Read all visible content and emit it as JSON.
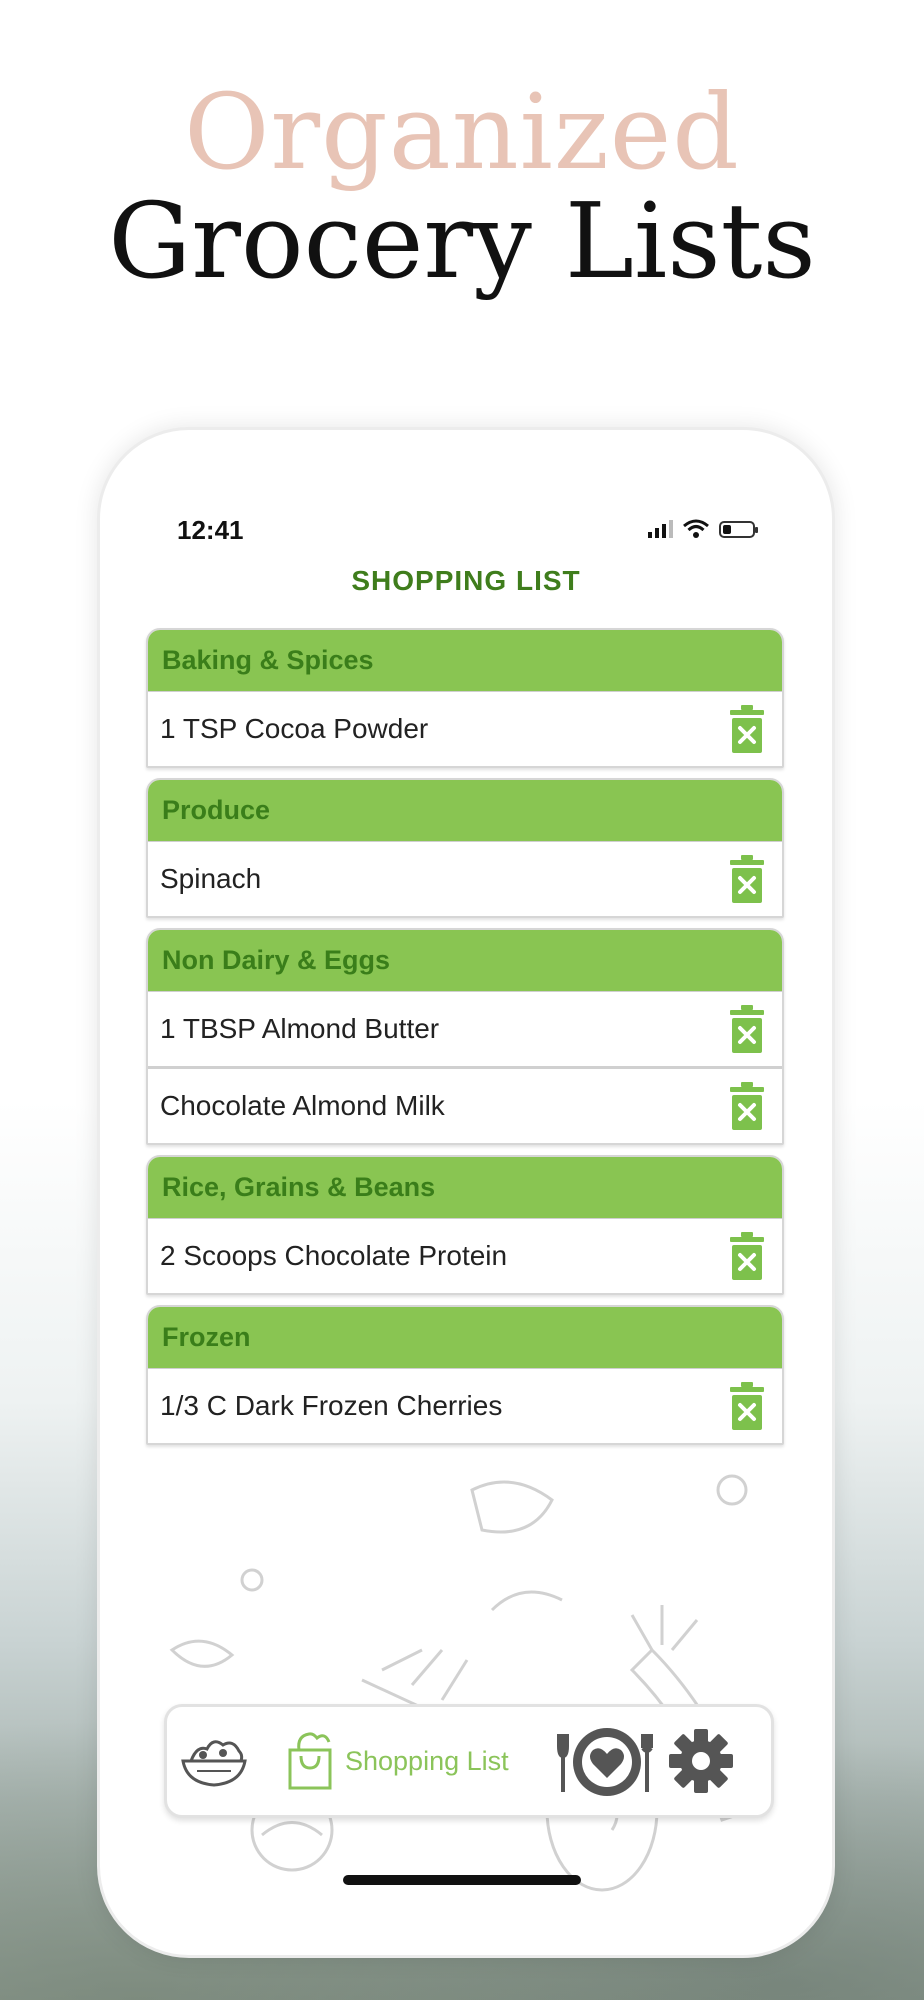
{
  "headline": {
    "line1": "Organized",
    "line2": "Grocery Lists"
  },
  "status_bar": {
    "time": "12:41"
  },
  "screen": {
    "title": "SHOPPING LIST",
    "categories": [
      {
        "name": "Baking & Spices",
        "items": [
          "1 TSP Cocoa Powder"
        ]
      },
      {
        "name": "Produce",
        "items": [
          "Spinach"
        ]
      },
      {
        "name": "Non Dairy & Eggs",
        "items": [
          "1 TBSP Almond Butter",
          "Chocolate Almond Milk"
        ]
      },
      {
        "name": "Rice, Grains & Beans",
        "items": [
          "2 Scoops Chocolate Protein"
        ]
      },
      {
        "name": "Frozen",
        "items": [
          "1/3 C Dark Frozen Cherries"
        ]
      }
    ]
  },
  "tabbar": {
    "tabs": [
      {
        "icon": "salad-bowl-icon"
      },
      {
        "icon": "shopping-bag-icon",
        "label": "Shopping List",
        "active": true
      },
      {
        "icon": "plate-heart-icon"
      },
      {
        "icon": "gear-icon"
      }
    ]
  },
  "colors": {
    "accent_green": "#89c552",
    "title_green": "#3f7d1c",
    "headline_pink": "#e8c4b6",
    "trash_green": "#7dc14c"
  }
}
